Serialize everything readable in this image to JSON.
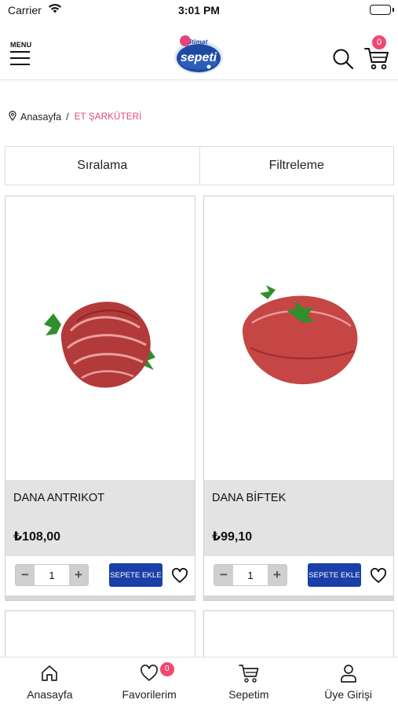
{
  "status_bar": {
    "carrier": "Carrier",
    "time": "3:01 PM"
  },
  "header": {
    "menu_label": "MENU",
    "logo_text_top": "itimat",
    "logo_text_main": "sepeti",
    "cart_count": "0"
  },
  "breadcrumb": {
    "home": "Anasayfa",
    "separator": "/",
    "current": "ET ŞARKÜTERİ"
  },
  "toolbar": {
    "sort": "Sıralama",
    "filter": "Filtreleme"
  },
  "products": [
    {
      "name": "DANA ANTRIKOT",
      "price": "₺108,00",
      "quantity": "1",
      "add_label": "SEPETE EKLE"
    },
    {
      "name": "DANA BİFTEK",
      "price": "₺99,10",
      "quantity": "1",
      "add_label": "SEPETE EKLE"
    }
  ],
  "stepper": {
    "minus": "−",
    "plus": "+"
  },
  "bottom_nav": {
    "home": "Anasayfa",
    "favorites": "Favorilerim",
    "favorites_count": "0",
    "cart": "Sepetim",
    "account": "Üye Girişi"
  },
  "colors": {
    "accent_pink": "#f04870",
    "button_blue": "#1a3fa8",
    "info_gray": "#e3e3e3"
  },
  "icons": [
    "wifi-icon",
    "battery-icon",
    "menu-icon",
    "search-icon",
    "cart-icon",
    "location-pin-icon",
    "heart-icon",
    "home-icon",
    "user-icon"
  ]
}
